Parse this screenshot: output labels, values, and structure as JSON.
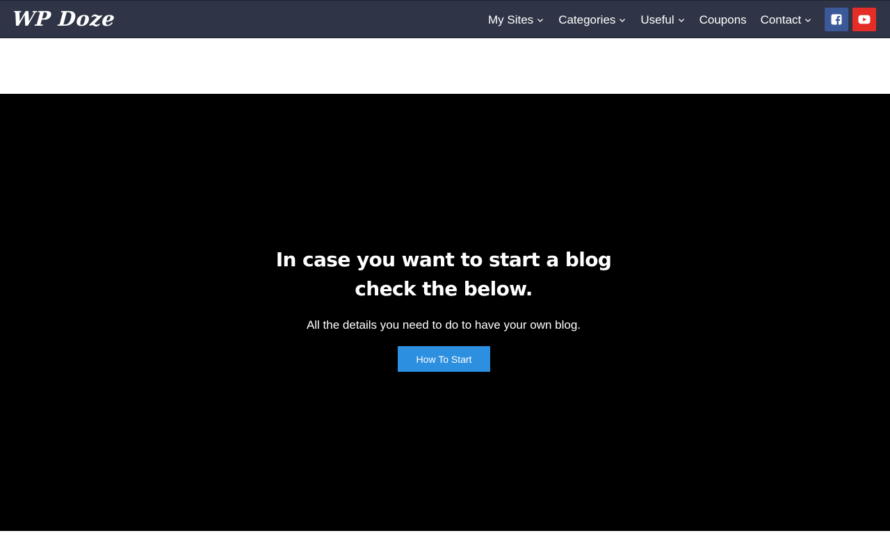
{
  "header": {
    "logo_text": "WP Doze",
    "nav": [
      {
        "label": "My Sites"
      },
      {
        "label": "Categories"
      },
      {
        "label": "Useful"
      },
      {
        "label": "Coupons"
      },
      {
        "label": "Contact"
      }
    ],
    "social": {
      "facebook_icon": "facebook-icon",
      "youtube_icon": "youtube-icon"
    }
  },
  "hero": {
    "title_line1": "In case you want to start a blog",
    "title_line2": "check the below.",
    "subtitle": "All the details you need to do to have your own blog.",
    "button_label": "How To Start"
  },
  "colors": {
    "header_bg": "#2f3546",
    "hero_bg": "#000000",
    "button_bg": "#2d8fe0",
    "facebook": "#3b5998",
    "youtube": "#e52d27"
  }
}
